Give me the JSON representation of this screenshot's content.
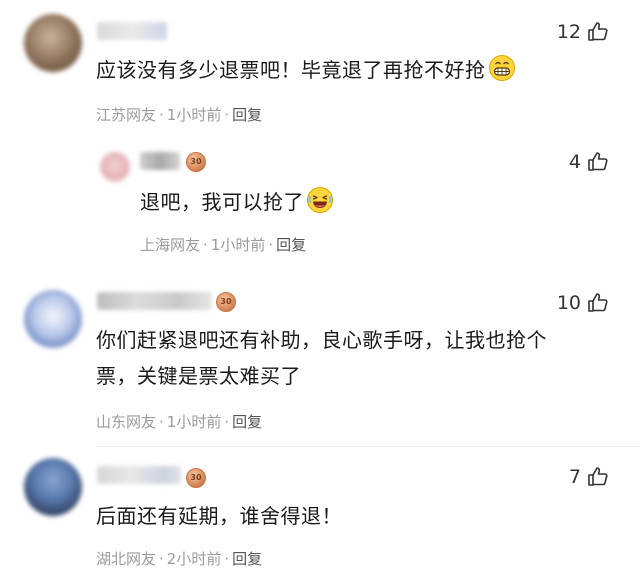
{
  "comments": [
    {
      "text": "应该没有多少退票吧！毕竟退了再抢不好抢",
      "emoji": "grin-emoji",
      "likes": "12",
      "location": "江苏网友",
      "time": "1小时前",
      "reply": "回复"
    },
    {
      "text": "退吧，我可以抢了",
      "emoji": "laugh-emoji",
      "likes": "4",
      "badge": "30",
      "location": "上海网友",
      "time": "1小时前",
      "reply": "回复"
    },
    {
      "text_line1": "你们赶紧退吧还有补助，良心歌手呀，让我也抢个",
      "text_line2": "票，关键是票太难买了",
      "likes": "10",
      "badge": "30",
      "location": "山东网友",
      "time": "1小时前",
      "reply": "回复"
    },
    {
      "text": "后面还有延期，谁舍得退！",
      "likes": "7",
      "badge": "30",
      "location": "湖北网友",
      "time": "2小时前",
      "reply": "回复"
    }
  ],
  "separator": "·",
  "colors": {
    "meta": "#9b9b9b",
    "text": "#1a1a1a",
    "badge": "#d9895b"
  }
}
